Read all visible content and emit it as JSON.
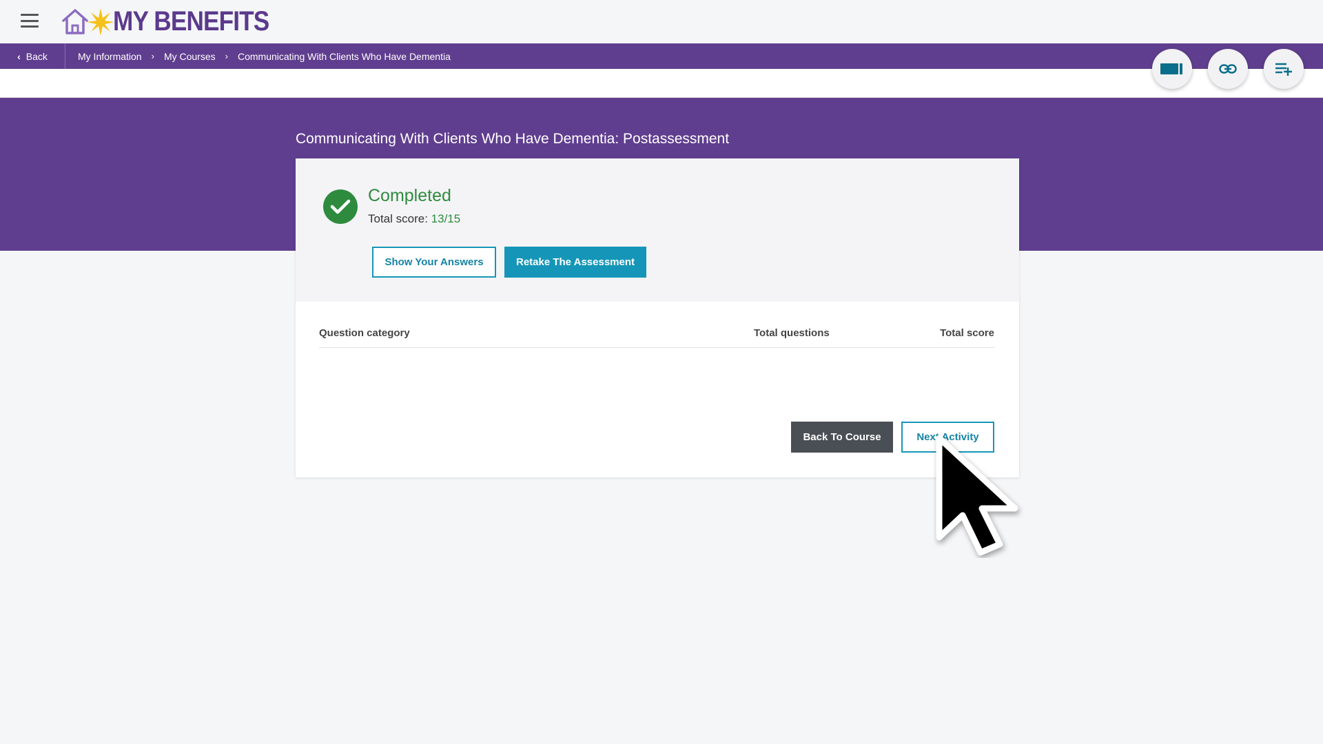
{
  "header": {
    "menu_icon": "hamburger-icon",
    "logo_icon": "house-sun-icon",
    "logo_text": "MY BENEFITS"
  },
  "breadcrumb": {
    "back_label": "Back",
    "items": [
      "My Information",
      "My Courses",
      "Communicating With Clients Who Have Dementia"
    ]
  },
  "toolbar": {
    "icons": [
      "video-icon",
      "link-icon",
      "playlist-add-icon"
    ]
  },
  "page": {
    "title": "Communicating With Clients Who Have Dementia: Postassessment"
  },
  "result": {
    "status": "Completed",
    "score_label": "Total score:",
    "score_value": "13/15",
    "show_answers_label": "Show Your Answers",
    "retake_label": "Retake The Assessment"
  },
  "table": {
    "columns": [
      "Question category",
      "Total questions",
      "Total score"
    ],
    "rows": []
  },
  "footer_actions": {
    "back_to_course_label": "Back To Course",
    "next_activity_label": "Next Activity"
  },
  "colors": {
    "brand_purple": "#603e8f",
    "success_green": "#2e8b3e",
    "accent_teal": "#1596b8",
    "logo_yellow": "#f5c21b"
  }
}
